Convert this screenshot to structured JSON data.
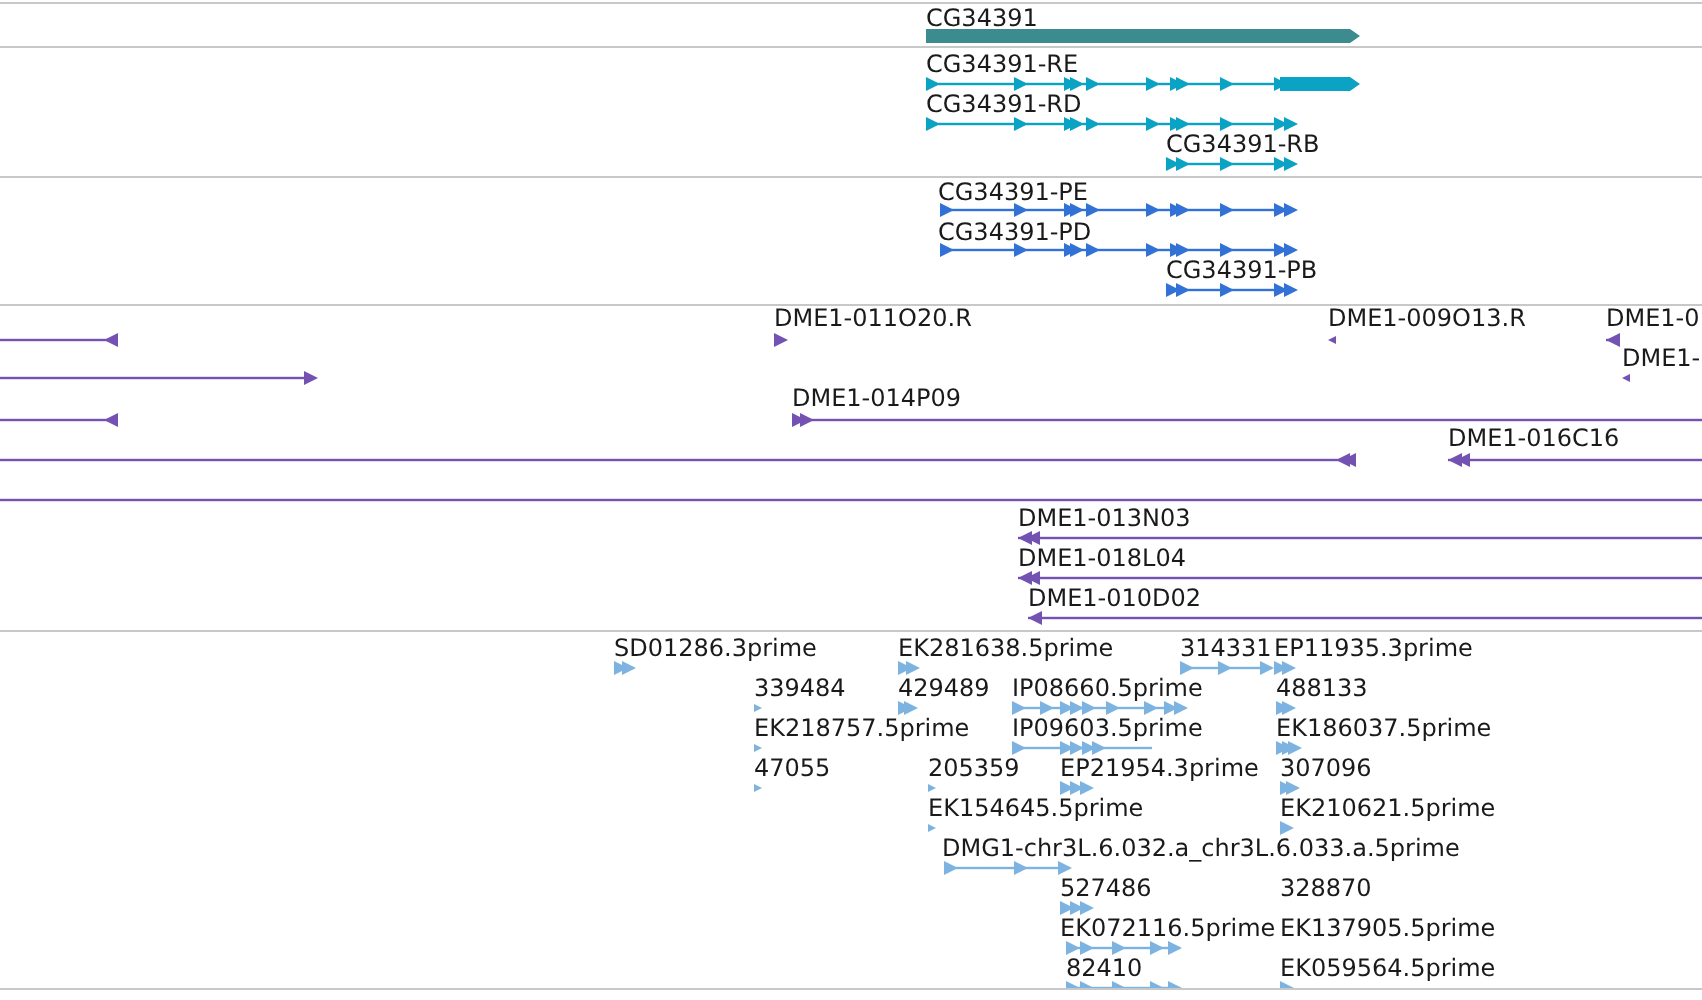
{
  "tracks": [
    {
      "kind": "gene",
      "features": [
        {
          "label": "CG34391",
          "reverse": false
        }
      ]
    },
    {
      "kind": "transcript",
      "features": [
        {
          "label": "CG34391-RE",
          "reverse": false
        },
        {
          "label": "CG34391-RD",
          "reverse": false
        },
        {
          "label": "CG34391-RB",
          "reverse": false
        }
      ]
    },
    {
      "kind": "protein",
      "features": [
        {
          "label": "CG34391-PE",
          "reverse": false
        },
        {
          "label": "CG34391-PD",
          "reverse": false
        },
        {
          "label": "CG34391-PB",
          "reverse": false
        }
      ]
    },
    {
      "kind": "clone",
      "features": [
        {
          "kind": "arrow",
          "reverse": true
        },
        {
          "kind": "arrow",
          "label": "DME1-011O20.R",
          "reverse": false
        },
        {
          "kind": "arrow",
          "label": "DME1-009O13.R",
          "reverse": true
        },
        {
          "kind": "arrow",
          "label": "DME1-0",
          "reverse": true
        },
        {
          "kind": "arrow",
          "reverse": false
        },
        {
          "kind": "arrow",
          "label": "DME1-",
          "reverse": true
        },
        {
          "kind": "arrow",
          "reverse": true
        },
        {
          "kind": "arrow",
          "label": "DME1-014P09",
          "reverse": false
        },
        {
          "kind": "arrow",
          "reverse": true
        },
        {
          "kind": "arrow",
          "label": "DME1-016C16",
          "reverse": true
        },
        {
          "kind": "line"
        },
        {
          "kind": "arrow",
          "label": "DME1-013N03",
          "reverse": true
        },
        {
          "kind": "arrow",
          "label": "DME1-018L04",
          "reverse": true
        },
        {
          "kind": "arrow",
          "label": "DME1-010D02",
          "reverse": true
        }
      ]
    },
    {
      "kind": "est",
      "features": [
        {
          "label": "SD01286.3prime",
          "reverse": false
        },
        {
          "label": "EK281638.5prime",
          "reverse": false
        },
        {
          "label": "314331",
          "reverse": false
        },
        {
          "label": "EP11935.3prime",
          "reverse": false
        },
        {
          "label": "339484",
          "reverse": false
        },
        {
          "label": "429489",
          "reverse": false
        },
        {
          "label": "IP08660.5prime",
          "reverse": false
        },
        {
          "label": "488133",
          "reverse": false
        },
        {
          "label": "EK218757.5prime",
          "reverse": false
        },
        {
          "label": "IP09603.5prime",
          "reverse": false
        },
        {
          "label": "EK186037.5prime",
          "reverse": false
        },
        {
          "label": "47055",
          "reverse": false
        },
        {
          "label": "205359",
          "reverse": false
        },
        {
          "label": "EP21954.3prime",
          "reverse": false
        },
        {
          "label": "307096",
          "reverse": false
        },
        {
          "label": "EK154645.5prime",
          "reverse": false
        },
        {
          "label": "EK210621.5prime",
          "reverse": false
        },
        {
          "label": "DMG1-chr3L.6.032.a_chr3L.6.033.a.5prime",
          "reverse": false
        },
        {
          "label": "527486",
          "reverse": false
        },
        {
          "label": "328870"
        },
        {
          "label": "EK072116.5prime",
          "reverse": false
        },
        {
          "label": "EK137905.5prime"
        },
        {
          "label": "82410",
          "reverse": false
        },
        {
          "label": "EK059564.5prime",
          "reverse": false
        }
      ]
    }
  ]
}
